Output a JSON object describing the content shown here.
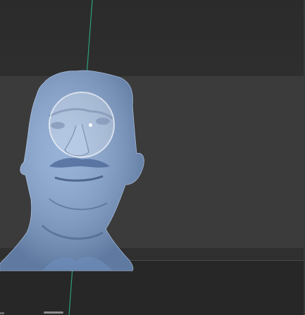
{
  "app": {
    "view": "3d-sculpt-viewport"
  },
  "viewport": {
    "background_color": "#2b2b2b",
    "mid_band_color": "#3b3b3b",
    "axis_color": "#2fb38a"
  },
  "mesh": {
    "object": "scanned-head-mesh",
    "color": "#7a9ccc",
    "wire_color": "#c9d9f2"
  },
  "brush": {
    "shape": "circle",
    "color": "#ffffff"
  },
  "icons": {
    "brush_cursor": "circle-brush-icon",
    "axis": "axis-line-icon"
  }
}
